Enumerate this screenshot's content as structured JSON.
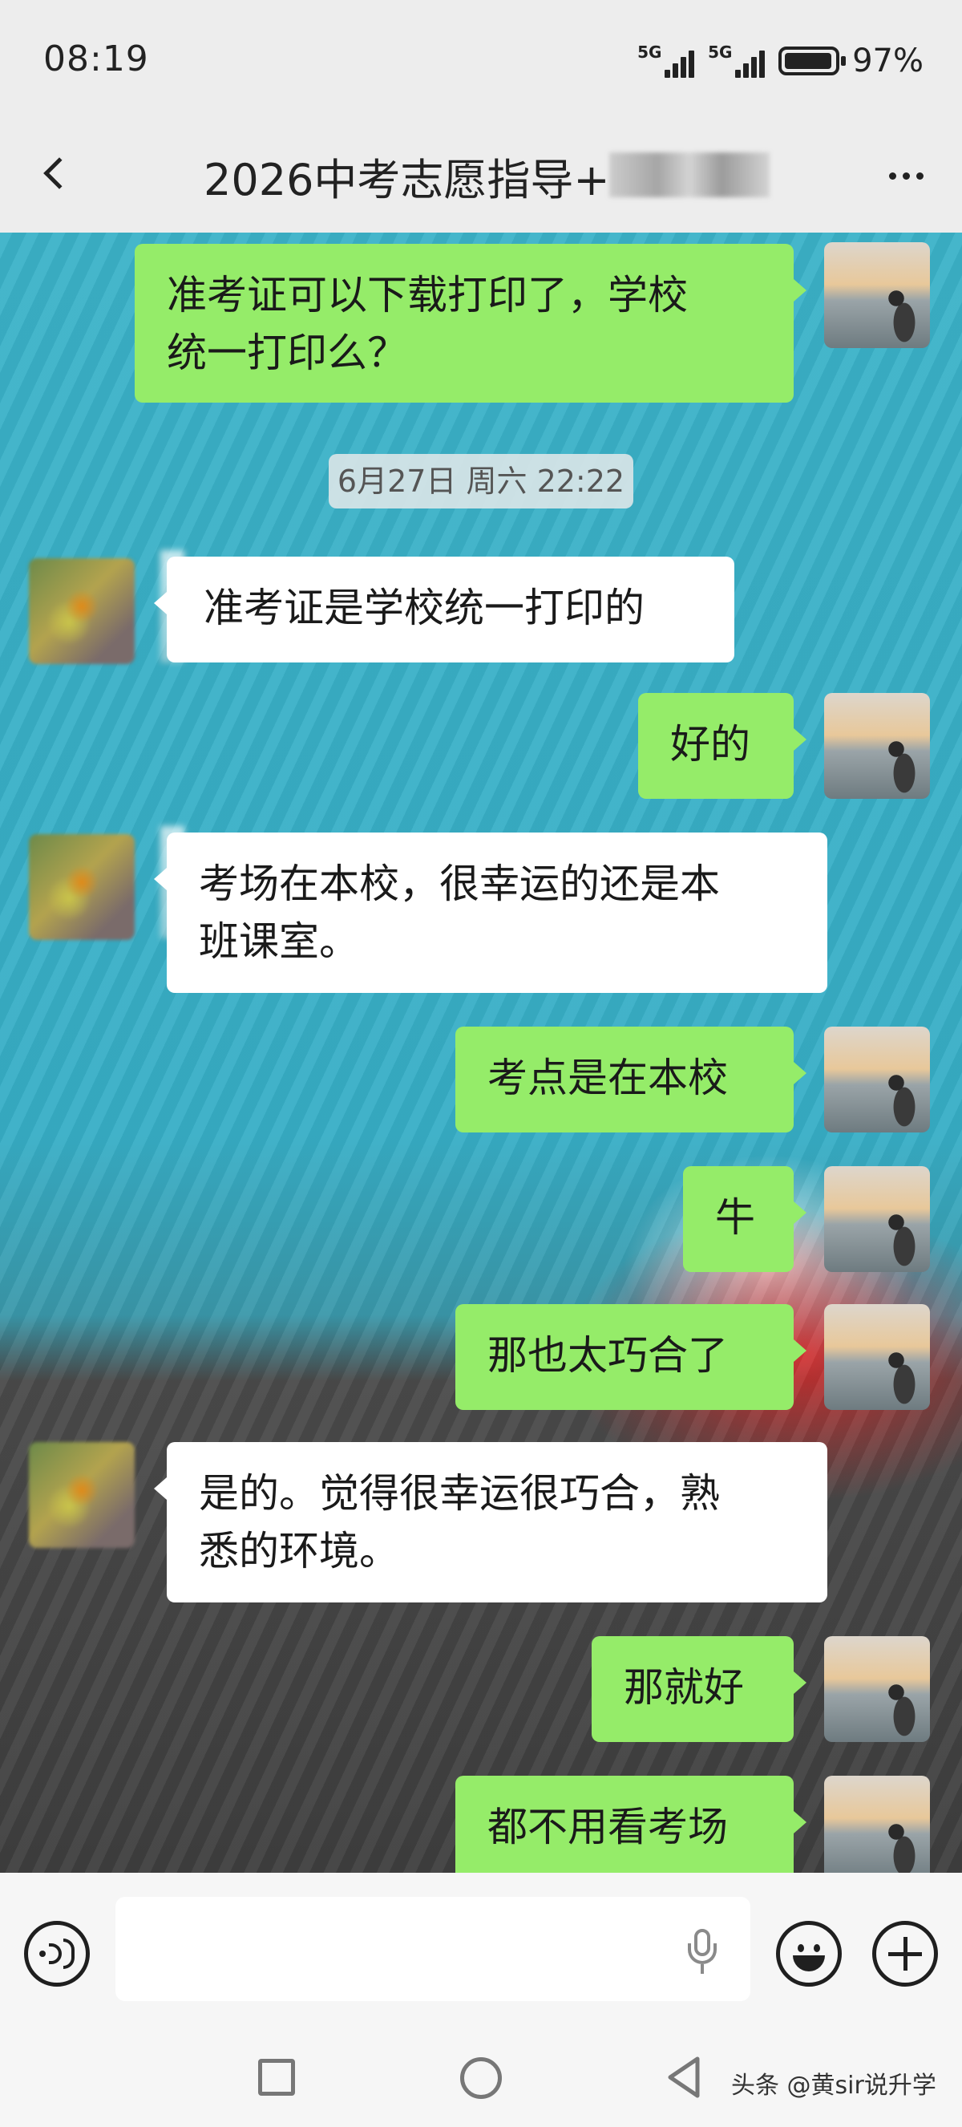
{
  "status": {
    "time": "08:19",
    "signal1": "5G",
    "signal2": "5G",
    "battery_percent": 97,
    "battery_text": "97%"
  },
  "header": {
    "title": "2026中考志愿指导+",
    "back_icon": "chevron-left-icon",
    "more_icon": "more-dots-icon"
  },
  "messages": [
    {
      "side": "out",
      "text_line1": "准考证可以下载打印了，学校",
      "text_line2": "统一打印么？"
    },
    {
      "type": "time",
      "text": "6月27日 周六 22:22"
    },
    {
      "side": "in",
      "text": "准考证是学校统一打印的"
    },
    {
      "side": "out",
      "text": "好的"
    },
    {
      "side": "in",
      "text_line1": "考场在本校，很幸运的还是本",
      "text_line2": "班课室。"
    },
    {
      "side": "out",
      "text": "考点是在本校"
    },
    {
      "side": "out",
      "text": "牛"
    },
    {
      "side": "out",
      "text": "那也太巧合了"
    },
    {
      "side": "in",
      "text_line1": "是的。觉得很幸运很巧合，熟",
      "text_line2": "悉的环境。"
    },
    {
      "side": "out",
      "text": "那就好"
    },
    {
      "side": "out",
      "text": "都不用看考场"
    }
  ],
  "input": {
    "placeholder": "",
    "value": ""
  },
  "nav": {
    "watermark": "头条 @黄sir说升学"
  }
}
